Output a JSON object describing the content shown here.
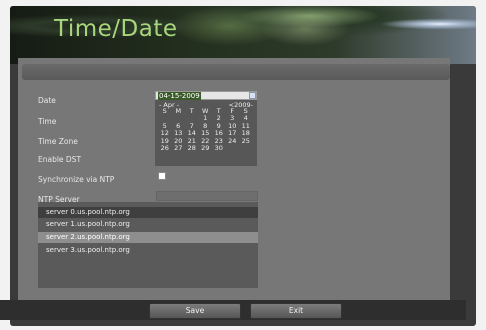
{
  "header": {
    "title": "Time/Date"
  },
  "form": {
    "date_label": "Date",
    "time_label": "Time",
    "timezone_label": "Time Zone",
    "dst_label": "Enable DST",
    "ntp_label": "Synchronize via NTP",
    "ntp_server_label": "NTP Server",
    "date_value": "04-15-2009",
    "ntp_checked": false
  },
  "calendar": {
    "month_nav": "- Apr -",
    "year_nav": "<2009-",
    "weekdays": [
      "S",
      "M",
      "T",
      "W",
      "T",
      "F",
      "S"
    ],
    "days": [
      "",
      "",
      "",
      "1",
      "2",
      "3",
      "4",
      "5",
      "6",
      "7",
      "8",
      "9",
      "10",
      "11",
      "12",
      "13",
      "14",
      "15",
      "16",
      "17",
      "18",
      "19",
      "20",
      "21",
      "22",
      "23",
      "24",
      "25",
      "26",
      "27",
      "28",
      "29",
      "30",
      "",
      ""
    ]
  },
  "ntp_servers": [
    "server 0.us.pool.ntp.org",
    "server 1.us.pool.ntp.org",
    "server 2.us.pool.ntp.org",
    "server 3.us.pool.ntp.org"
  ],
  "buttons": {
    "save": "Save",
    "exit": "Exit"
  },
  "colors": {
    "title": "#a8d67c",
    "selected_row": "#8e8e8e"
  }
}
